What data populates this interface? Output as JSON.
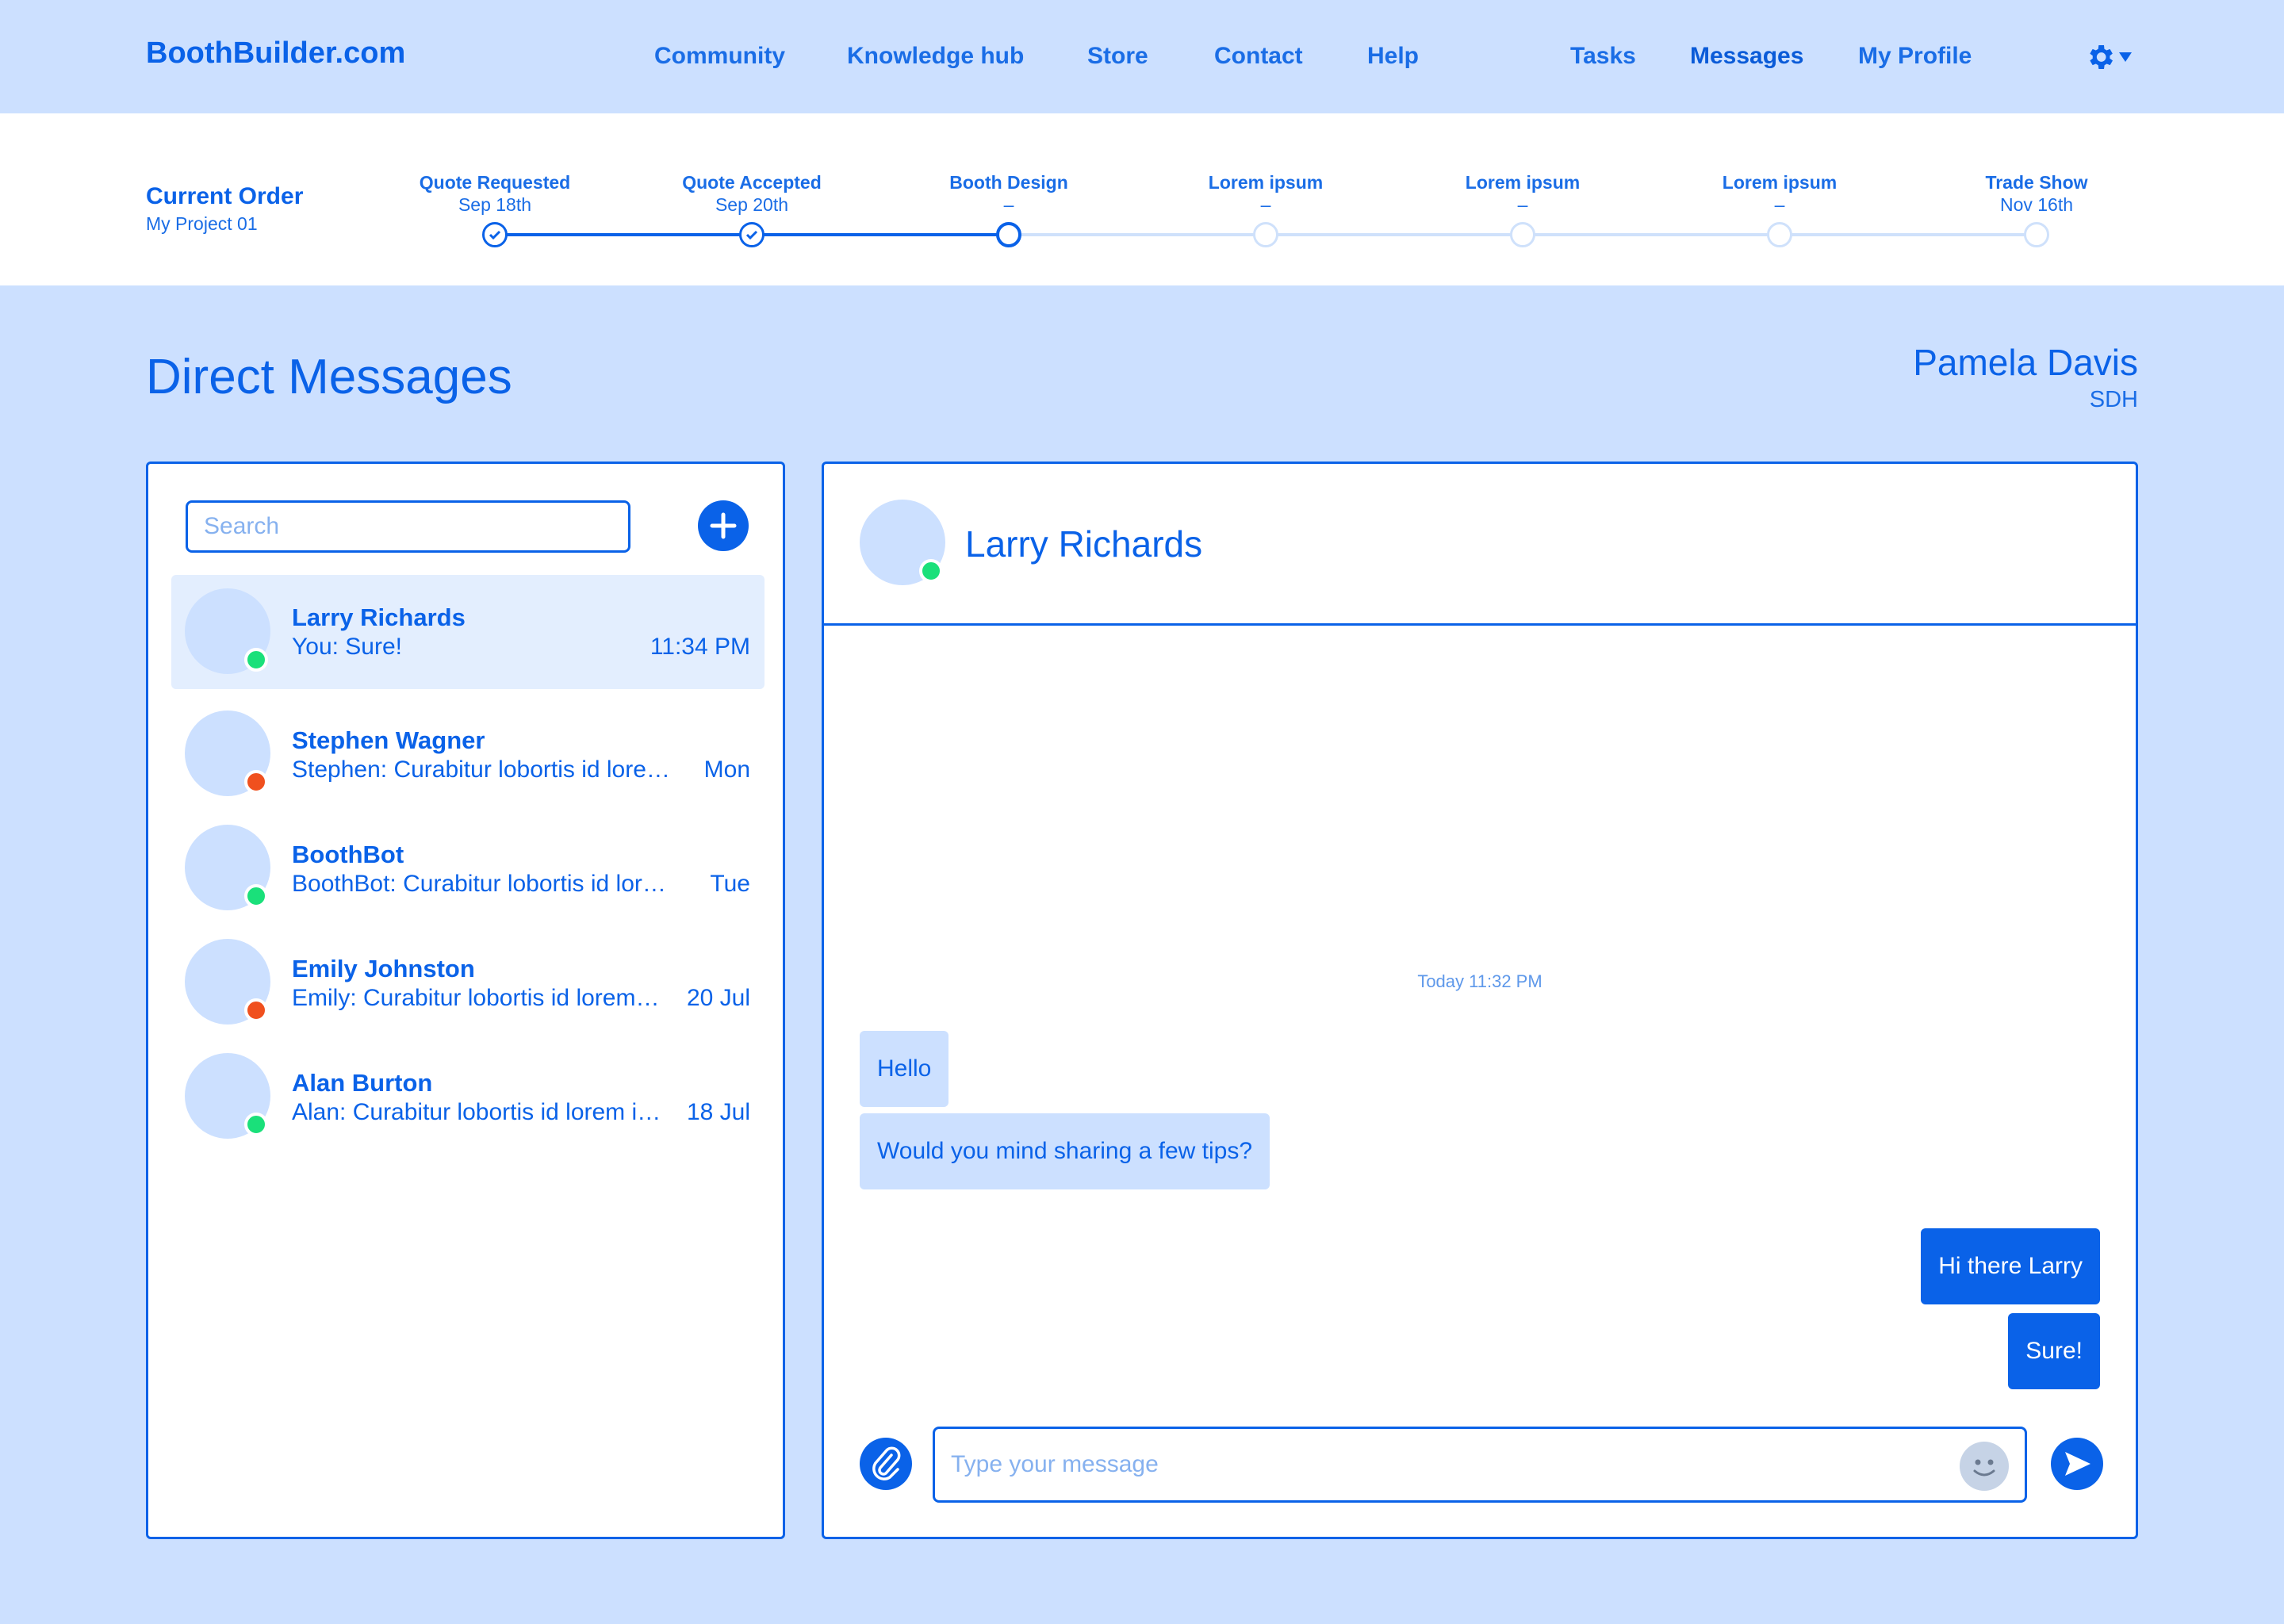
{
  "brand": "BoothBuilder.com",
  "nav": {
    "community": "Community",
    "knowledge_hub": "Knowledge hub",
    "store": "Store",
    "contact": "Contact",
    "help": "Help",
    "tasks": "Tasks",
    "messages": "Messages",
    "my_profile": "My Profile"
  },
  "order": {
    "title": "Current Order",
    "project": "My Project 01",
    "steps": [
      {
        "label": "Quote Requested",
        "date": "Sep 18th",
        "state": "done"
      },
      {
        "label": "Quote Accepted",
        "date": "Sep 20th",
        "state": "done"
      },
      {
        "label": "Booth Design",
        "date": "–",
        "state": "current"
      },
      {
        "label": "Lorem ipsum",
        "date": "–",
        "state": "todo"
      },
      {
        "label": "Lorem ipsum",
        "date": "–",
        "state": "todo"
      },
      {
        "label": "Lorem ipsum",
        "date": "–",
        "state": "todo"
      },
      {
        "label": "Trade Show",
        "date": "Nov 16th",
        "state": "todo"
      }
    ]
  },
  "page_title": "Direct Messages",
  "user": {
    "name": "Pamela Davis",
    "org": "SDH"
  },
  "search": {
    "placeholder": "Search"
  },
  "conversations": [
    {
      "name": "Larry Richards",
      "preview": "You: Sure!",
      "time": "11:34 PM",
      "status": "online",
      "status_color": "#1ae07a"
    },
    {
      "name": "Stephen Wagner",
      "preview": "Stephen: Curabitur lobortis id lorem id bibendum",
      "time": "Mon",
      "status": "busy",
      "status_color": "#f0501e"
    },
    {
      "name": "BoothBot",
      "preview": "BoothBot: Curabitur lobortis id lorem id bibendum",
      "time": "Tue",
      "status": "online",
      "status_color": "#1ae07a"
    },
    {
      "name": "Emily Johnston",
      "preview": "Emily: Curabitur lobortis id lorem id bibendum",
      "time": "20 Jul",
      "status": "busy",
      "status_color": "#f0501e"
    },
    {
      "name": "Alan Burton",
      "preview": "Alan: Curabitur lobortis id lorem id bibendum",
      "time": "18 Jul",
      "status": "online",
      "status_color": "#1ae07a"
    }
  ],
  "chat": {
    "contact_name": "Larry Richards",
    "timestamp": "Today 11:32 PM",
    "messages": [
      {
        "text": "Hello",
        "direction": "in"
      },
      {
        "text": "Would you mind sharing a few tips?",
        "direction": "in"
      },
      {
        "text": "Hi there Larry",
        "direction": "out"
      },
      {
        "text": "Sure!",
        "direction": "out"
      }
    ],
    "input_placeholder": "Type your message"
  },
  "colors": {
    "primary": "#0a62e8",
    "background": "#cce0ff",
    "selected_row": "#e3eefe",
    "online": "#1ae07a",
    "busy": "#f0501e"
  },
  "icons": [
    "gear-icon",
    "chevron-down-icon",
    "check-icon",
    "plus-icon",
    "paperclip-icon",
    "smiley-icon",
    "send-icon"
  ]
}
